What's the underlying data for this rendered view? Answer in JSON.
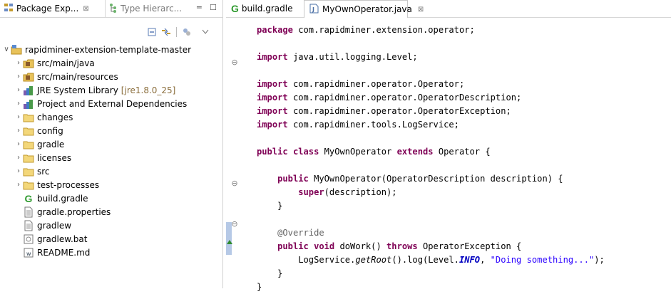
{
  "left_panel": {
    "tabs": [
      {
        "label": "Package Exp...",
        "close": "⊠",
        "active": true
      },
      {
        "label": "Type Hierarc...",
        "active": false
      }
    ],
    "window_controls": {
      "minimize": "═",
      "maximize": "☐"
    },
    "tree": {
      "root": {
        "label": "rapidminer-extension-template-master"
      },
      "items": [
        {
          "label": "src/main/java",
          "icon": "package-folder-icon",
          "expandable": true
        },
        {
          "label": "src/main/resources",
          "icon": "package-folder-icon",
          "expandable": true
        },
        {
          "label": "JRE System Library",
          "suffix": "[jre1.8.0_25]",
          "icon": "library-icon",
          "expandable": true
        },
        {
          "label": "Project and External Dependencies",
          "icon": "library-icon",
          "expandable": true
        },
        {
          "label": "changes",
          "icon": "folder-icon",
          "expandable": true
        },
        {
          "label": "config",
          "icon": "folder-icon",
          "expandable": true
        },
        {
          "label": "gradle",
          "icon": "folder-icon",
          "expandable": true
        },
        {
          "label": "licenses",
          "icon": "folder-icon",
          "expandable": true
        },
        {
          "label": "src",
          "icon": "folder-icon",
          "expandable": true
        },
        {
          "label": "test-processes",
          "icon": "folder-icon",
          "expandable": true
        },
        {
          "label": "build.gradle",
          "icon": "gradle-file-icon",
          "expandable": false
        },
        {
          "label": "gradle.properties",
          "icon": "text-file-icon",
          "expandable": false
        },
        {
          "label": "gradlew",
          "icon": "text-file-icon",
          "expandable": false
        },
        {
          "label": "gradlew.bat",
          "icon": "bat-file-icon",
          "expandable": false
        },
        {
          "label": "README.md",
          "icon": "markdown-file-icon",
          "expandable": false
        }
      ]
    }
  },
  "editor": {
    "tabs": [
      {
        "label": "build.gradle",
        "active": false
      },
      {
        "label": "MyOwnOperator.java",
        "close": "⊠",
        "active": true
      }
    ],
    "code": [
      "package com.rapidminer.extension.operator;",
      "",
      "import java.util.logging.Level;",
      "",
      "import com.rapidminer.operator.Operator;",
      "import com.rapidminer.operator.OperatorDescription;",
      "import com.rapidminer.operator.OperatorException;",
      "import com.rapidminer.tools.LogService;",
      "",
      "public class MyOwnOperator extends Operator {",
      "",
      "    public MyOwnOperator(OperatorDescription description) {",
      "        super(description);",
      "    }",
      "",
      "    @Override",
      "    public void doWork() throws OperatorException {",
      "        LogService.getRoot().log(Level.INFO, \"Doing something...\");",
      "    }",
      "}"
    ]
  },
  "colors": {
    "keyword": "#7f0055",
    "string": "#2a00ff",
    "annotation": "#646464",
    "field": "#0000c0"
  }
}
